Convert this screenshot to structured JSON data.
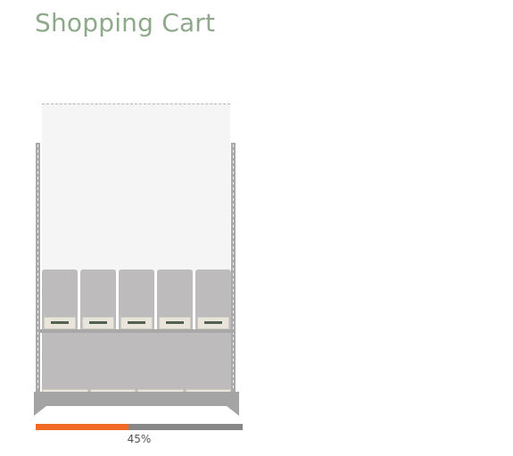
{
  "title": "Shopping Cart",
  "progress": {
    "value": 0.45,
    "label": "45%"
  },
  "colors": {
    "title": "#8ea88a",
    "progress_fill": "#ee6a25",
    "progress_track": "#878787",
    "bin": "#bdbbbc",
    "label": "#e9e5dd",
    "label_mark": "#52624f"
  },
  "cart": {
    "top_row_bins": 5,
    "bottom_row_labels": 4
  }
}
